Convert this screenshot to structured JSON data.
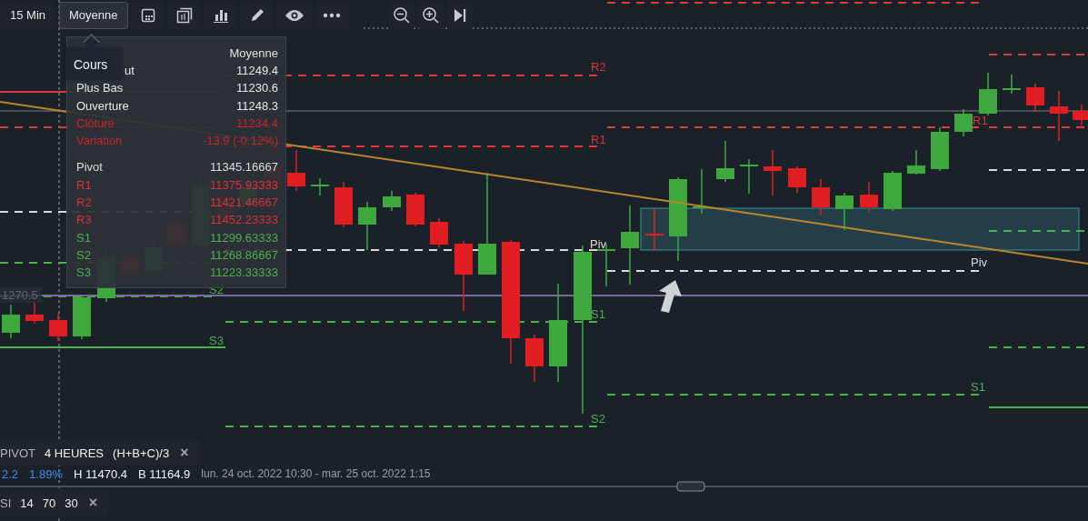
{
  "toolbar": {
    "buttons": [
      {
        "label": "15 Min",
        "selected": false
      },
      {
        "label": "Moyenne",
        "selected": true
      }
    ]
  },
  "tooltip": {
    "popup": "Cours",
    "header": "Moyenne",
    "rows": [
      {
        "label": "ut",
        "value": "11249.4",
        "kind": "neutral"
      },
      {
        "label": "Plus Bas",
        "value": "11230.6",
        "kind": "neutral"
      },
      {
        "label": "Ouverture",
        "value": "11248.3",
        "kind": "neutral"
      },
      {
        "label": "Clôture",
        "value": "11234.4",
        "kind": "down"
      },
      {
        "label": "Variation",
        "value": "-13.9 (-0.12%)",
        "kind": "down"
      },
      {
        "label": "Pivot",
        "value": "11345.16667",
        "kind": "pivot",
        "gap": true
      },
      {
        "label": "R1",
        "value": "11375.93333",
        "kind": "resistance"
      },
      {
        "label": "R2",
        "value": "11421.46667",
        "kind": "resistance"
      },
      {
        "label": "R3",
        "value": "11452.23333",
        "kind": "resistance"
      },
      {
        "label": "S1",
        "value": "11299.63333",
        "kind": "support"
      },
      {
        "label": "S2",
        "value": "11268.86667",
        "kind": "support"
      },
      {
        "label": "S3",
        "value": "11223.33333",
        "kind": "support"
      }
    ]
  },
  "chart": {
    "price_tag": "1270.5",
    "level_labels": [
      {
        "text": "R2",
        "kind": "resistance"
      },
      {
        "text": "R1",
        "kind": "resistance"
      },
      {
        "text": "Piv",
        "kind": "pivot"
      },
      {
        "text": "S1",
        "kind": "support"
      },
      {
        "text": "S2",
        "kind": "support"
      },
      {
        "text": "S2",
        "kind": "support"
      },
      {
        "text": "S3",
        "kind": "support"
      },
      {
        "text": "R1",
        "kind": "resistance"
      },
      {
        "text": "Piv",
        "kind": "pivot"
      },
      {
        "text": "S1",
        "kind": "support"
      }
    ]
  },
  "legend": {
    "pivot": {
      "name": "PIVOT",
      "period": "4 HEURES",
      "formula": "(H+B+C)/3",
      "close": "×"
    },
    "stats": [
      {
        "text": "2.2",
        "kind": "change"
      },
      {
        "text": "1.89%",
        "kind": "change"
      },
      {
        "text": "H 11470.4",
        "kind": "value"
      },
      {
        "text": "B 11164.9",
        "kind": "value"
      },
      {
        "text": "lun. 24 oct. 2022 10:30 - mar. 25 oct. 2022 1:15",
        "kind": "range"
      }
    ],
    "rsi": {
      "name": "SI",
      "params": [
        "14",
        "70",
        "30"
      ],
      "close": "×"
    }
  }
}
